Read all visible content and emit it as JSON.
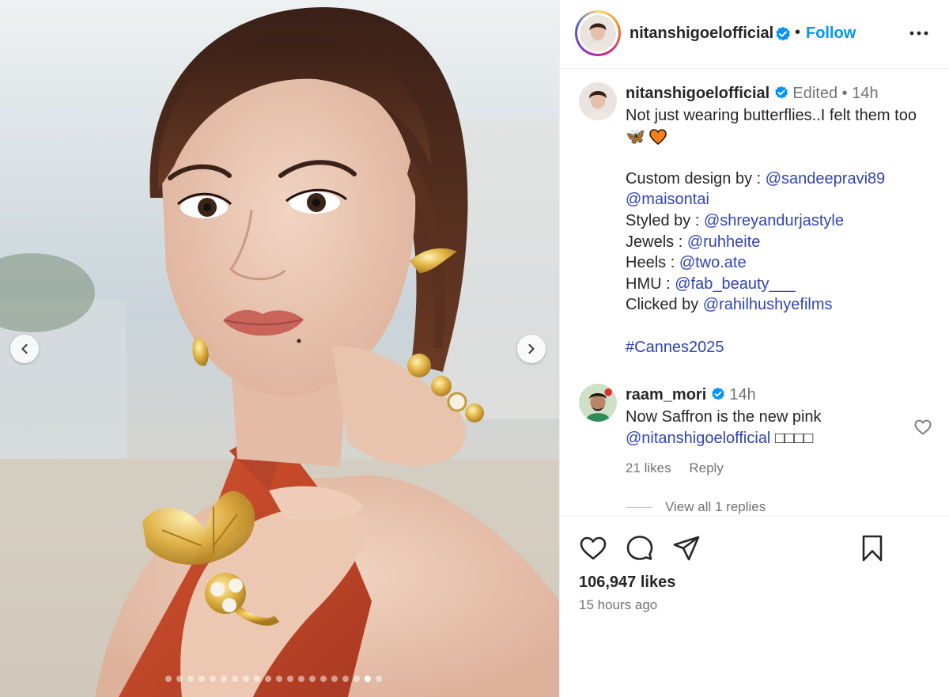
{
  "post": {
    "username": "nitanshigoelofficial",
    "follow_label": "Follow",
    "separator": "•"
  },
  "media": {
    "image_count": 20,
    "active_index": 18,
    "colors": {
      "dress": "#c8452b",
      "gold": "#d9a93a",
      "skin": "#e9c3ae",
      "hair": "#4a2a1c"
    }
  },
  "caption": {
    "username": "nitanshigoelofficial",
    "edited": "Edited",
    "dot": "•",
    "time": "14h",
    "line1": "Not just wearing butterflies..I felt them too",
    "emoji": "🦋",
    "design_label": "Custom design by : ",
    "design_mention1": "@sandeepravi89",
    "design_mention2": "@maisontai",
    "styled_label": "Styled by : ",
    "styled_mention": "@shreyandurjastyle",
    "jewels_label": "Jewels : ",
    "jewels_mention": "@ruhheite",
    "heels_label": "Heels : ",
    "heels_mention": "@two.ate",
    "hmu_label": "HMU : ",
    "hmu_mention": "@fab_beauty___",
    "clicked_label": "Clicked by ",
    "clicked_mention": "@rahilhushyefilms",
    "hashtag": "#Cannes2025"
  },
  "comment": {
    "username": "raam_mori",
    "time": "14h",
    "text": "Now Saffron is the new pink",
    "mention": "@nitanshigoelofficial",
    "trailing": "□□□□",
    "likes": "21 likes",
    "reply_label": "Reply",
    "view_replies": "View all 1 replies"
  },
  "footer": {
    "likes": "106,947 likes",
    "posted": "15 hours ago"
  },
  "icons": [
    "chevron-left-icon",
    "chevron-right-icon",
    "verified-icon",
    "more-icon",
    "heart-icon",
    "comment-icon",
    "share-icon",
    "bookmark-icon"
  ],
  "accent": "#0095f6",
  "mention_color": "#3044b8",
  "verified_color": "#0095f6"
}
